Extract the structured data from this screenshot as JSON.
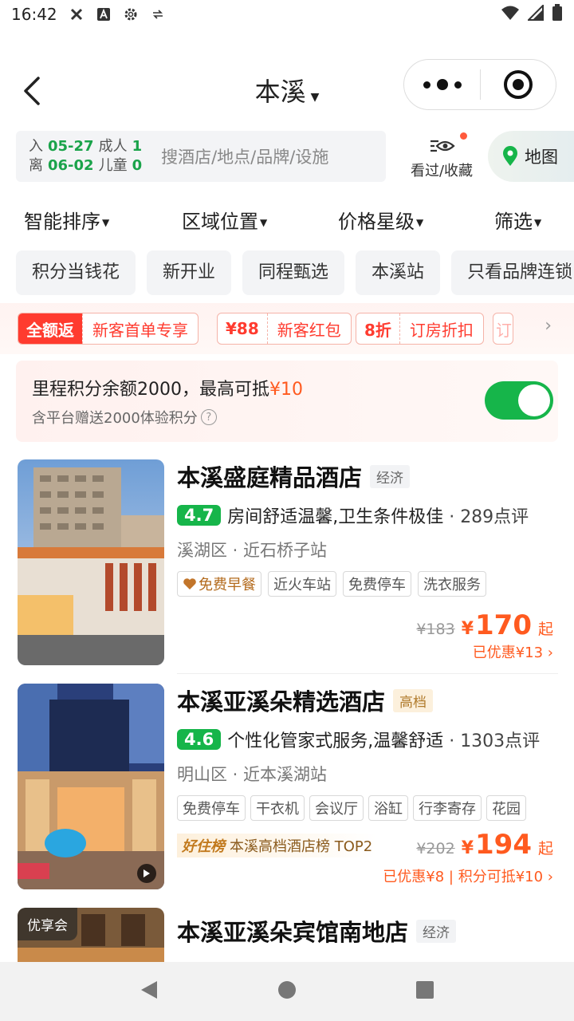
{
  "status_bar": {
    "time": "16:42"
  },
  "header": {
    "title": "本溪"
  },
  "search": {
    "checkin_label": "入",
    "checkin_date": "05-27",
    "checkout_label": "离",
    "checkout_date": "06-02",
    "adult_label": "成人",
    "adult_count": "1",
    "child_label": "儿童",
    "child_count": "0",
    "placeholder": "搜酒店/地点/品牌/设施",
    "viewed_label": "看过/收藏",
    "map_label": "地图"
  },
  "sort": [
    "智能排序",
    "区域位置",
    "价格星级",
    "筛选"
  ],
  "quick_tags": [
    "积分当钱花",
    "新开业",
    "同程甄选",
    "本溪站",
    "只看品牌连锁"
  ],
  "promos": [
    {
      "left": "全额返",
      "right": "新客首单专享"
    },
    {
      "left": "¥88",
      "right": "新客红包"
    },
    {
      "left": "8折",
      "right": "订房折扣"
    },
    {
      "left": "订",
      "right": ""
    }
  ],
  "points": {
    "line1_prefix": "里程积分余额2000，最高可抵",
    "line1_value": "¥10",
    "line2": "含平台赠送2000体验积分",
    "toggle_on": true
  },
  "hotels": [
    {
      "name": "本溪盛庭精品酒店",
      "grade": "经济",
      "score": "4.7",
      "summary": "房间舒适温馨,卫生条件极佳",
      "reviews": "· 289点评",
      "location": "溪湖区 · 近石桥子站",
      "facilities": [
        "免费早餐",
        "近火车站",
        "免费停车",
        "洗衣服务"
      ],
      "old_price": "¥183",
      "yen": "¥",
      "price": "170",
      "qi": "起",
      "discount": "已优惠¥13 ›"
    },
    {
      "name": "本溪亚溪朵精选酒店",
      "grade": "高档",
      "score": "4.6",
      "summary": "个性化管家式服务,温馨舒适",
      "reviews": "· 1303点评",
      "location": "明山区 · 近本溪湖站",
      "facilities": [
        "免费停车",
        "干衣机",
        "会议厅",
        "浴缸",
        "行李寄存",
        "花园"
      ],
      "rank_badge": "好住榜",
      "rank_text": "本溪高档酒店榜 TOP2",
      "old_price": "¥202",
      "yen": "¥",
      "price": "194",
      "qi": "起",
      "discount": "已优惠¥8 | 积分可抵¥10 ›"
    },
    {
      "name": "本溪亚溪朵宾馆南地店",
      "grade": "经济",
      "photo_badge": "优享会"
    }
  ]
}
